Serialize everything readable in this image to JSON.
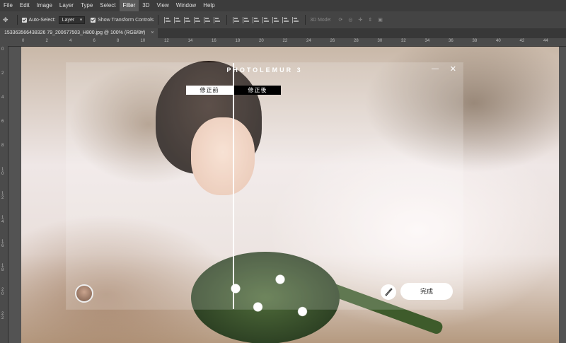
{
  "menubar": {
    "items": [
      "File",
      "Edit",
      "Image",
      "Layer",
      "Type",
      "Select",
      "Filter",
      "3D",
      "View",
      "Window",
      "Help"
    ],
    "active_index": 6
  },
  "options": {
    "auto_select_label": "Auto-Select:",
    "auto_select_value": "Layer",
    "show_transform_label": "Show Transform Controls",
    "mode_3d_label": "3D Mode:"
  },
  "document_tab": {
    "title": "153363566438326 79_200677503_H800.jpg @ 100% (RGB/8#)",
    "close": "×"
  },
  "rulers": {
    "top": [
      "0",
      "2",
      "4",
      "6",
      "8",
      "10",
      "12",
      "14",
      "16",
      "18",
      "20",
      "22",
      "24",
      "26",
      "28",
      "30",
      "32",
      "34",
      "36",
      "38",
      "40",
      "42",
      "44"
    ],
    "left": [
      "0",
      "2",
      "4",
      "6",
      "8",
      "1 0",
      "1 2",
      "1 4",
      "1 6",
      "1 8",
      "2 0",
      "2 2"
    ]
  },
  "dialog": {
    "title": "PHOTOLEMUR 3",
    "minimize": "—",
    "close": "✕",
    "label_before": "修正前",
    "label_after": "修正後",
    "done_label": "完成"
  },
  "icons": {
    "brush": "brush-icon",
    "avatar": "avatar"
  }
}
